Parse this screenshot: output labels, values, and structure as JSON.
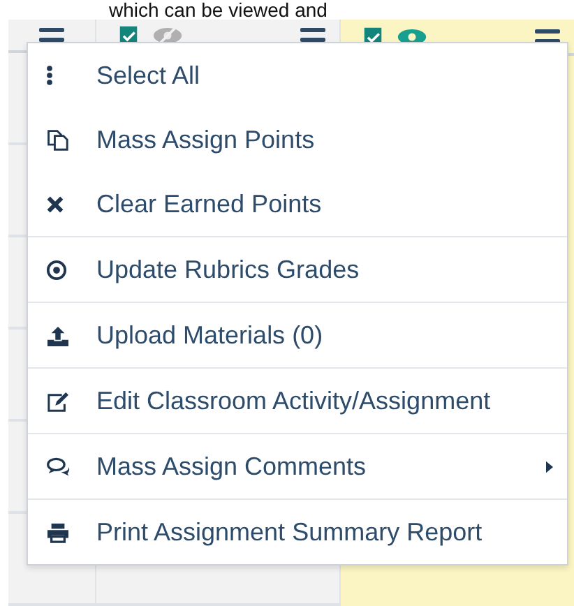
{
  "caption": "which can be viewed and",
  "menu": {
    "items": [
      {
        "label": "Select All",
        "kind": "dots",
        "divider_before": false,
        "has_submenu": false
      },
      {
        "label": "Mass Assign Points",
        "kind": "copy",
        "divider_before": false,
        "has_submenu": false
      },
      {
        "label": "Clear Earned Points",
        "kind": "x",
        "divider_before": false,
        "has_submenu": false
      },
      {
        "label": "Update Rubrics Grades",
        "kind": "target",
        "divider_before": true,
        "has_submenu": false
      },
      {
        "label": "Upload Materials (0)",
        "kind": "upload",
        "divider_before": true,
        "has_submenu": false
      },
      {
        "label": "Edit Classroom Activity/Assignment",
        "kind": "edit",
        "divider_before": true,
        "has_submenu": false
      },
      {
        "label": "Mass Assign Comments",
        "kind": "comments",
        "divider_before": true,
        "has_submenu": true
      },
      {
        "label": "Print Assignment Summary Report",
        "kind": "print",
        "divider_before": true,
        "has_submenu": false
      }
    ]
  }
}
